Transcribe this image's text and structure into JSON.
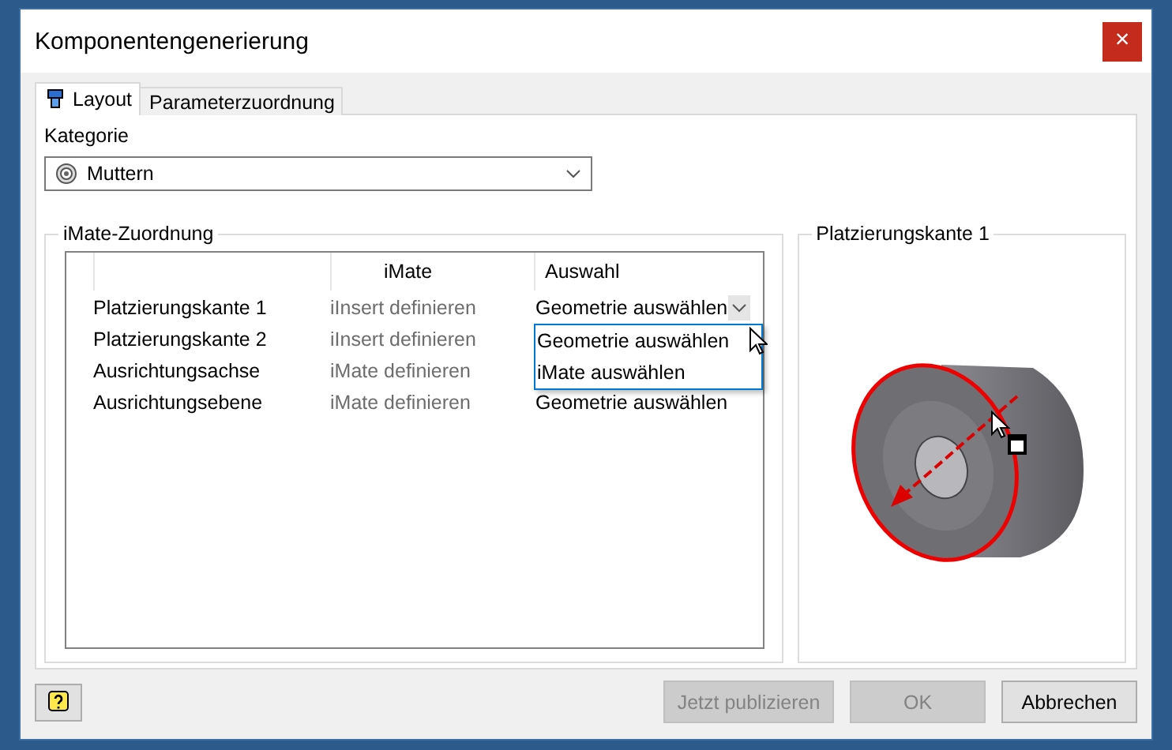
{
  "window": {
    "title": "Komponentengenerierung",
    "close": "×"
  },
  "tabs": [
    {
      "label": "Layout",
      "selected": true,
      "icon": true
    },
    {
      "label": "Parameterzuordnung",
      "selected": false,
      "icon": false
    }
  ],
  "category": {
    "label": "Kategorie",
    "value": "Muttern"
  },
  "mapping": {
    "title": "iMate-Zuordnung",
    "columns": [
      "iMate",
      "Auswahl"
    ],
    "rows": [
      {
        "name": "Platzierungskante 1",
        "imate": "iInsert definieren",
        "selection": "Geometrie auswählen",
        "expanded": true,
        "options": [
          "Geometrie auswählen",
          "iMate auswählen"
        ]
      },
      {
        "name": "Platzierungskante 2",
        "imate": "iInsert definieren",
        "expanded": false
      },
      {
        "name": "Ausrichtungsachse",
        "imate": "iMate definieren",
        "expanded": false
      },
      {
        "name": "Ausrichtungsebene",
        "imate": "iMate definieren",
        "selection": "Geometrie auswählen",
        "expanded": false
      }
    ]
  },
  "preview": {
    "title": "Platzierungskante 1"
  },
  "buttons": [
    {
      "label": "Jetzt publizieren",
      "disabled": true
    },
    {
      "label": "OK",
      "disabled": true
    },
    {
      "label": "Abbrechen",
      "disabled": false
    }
  ]
}
